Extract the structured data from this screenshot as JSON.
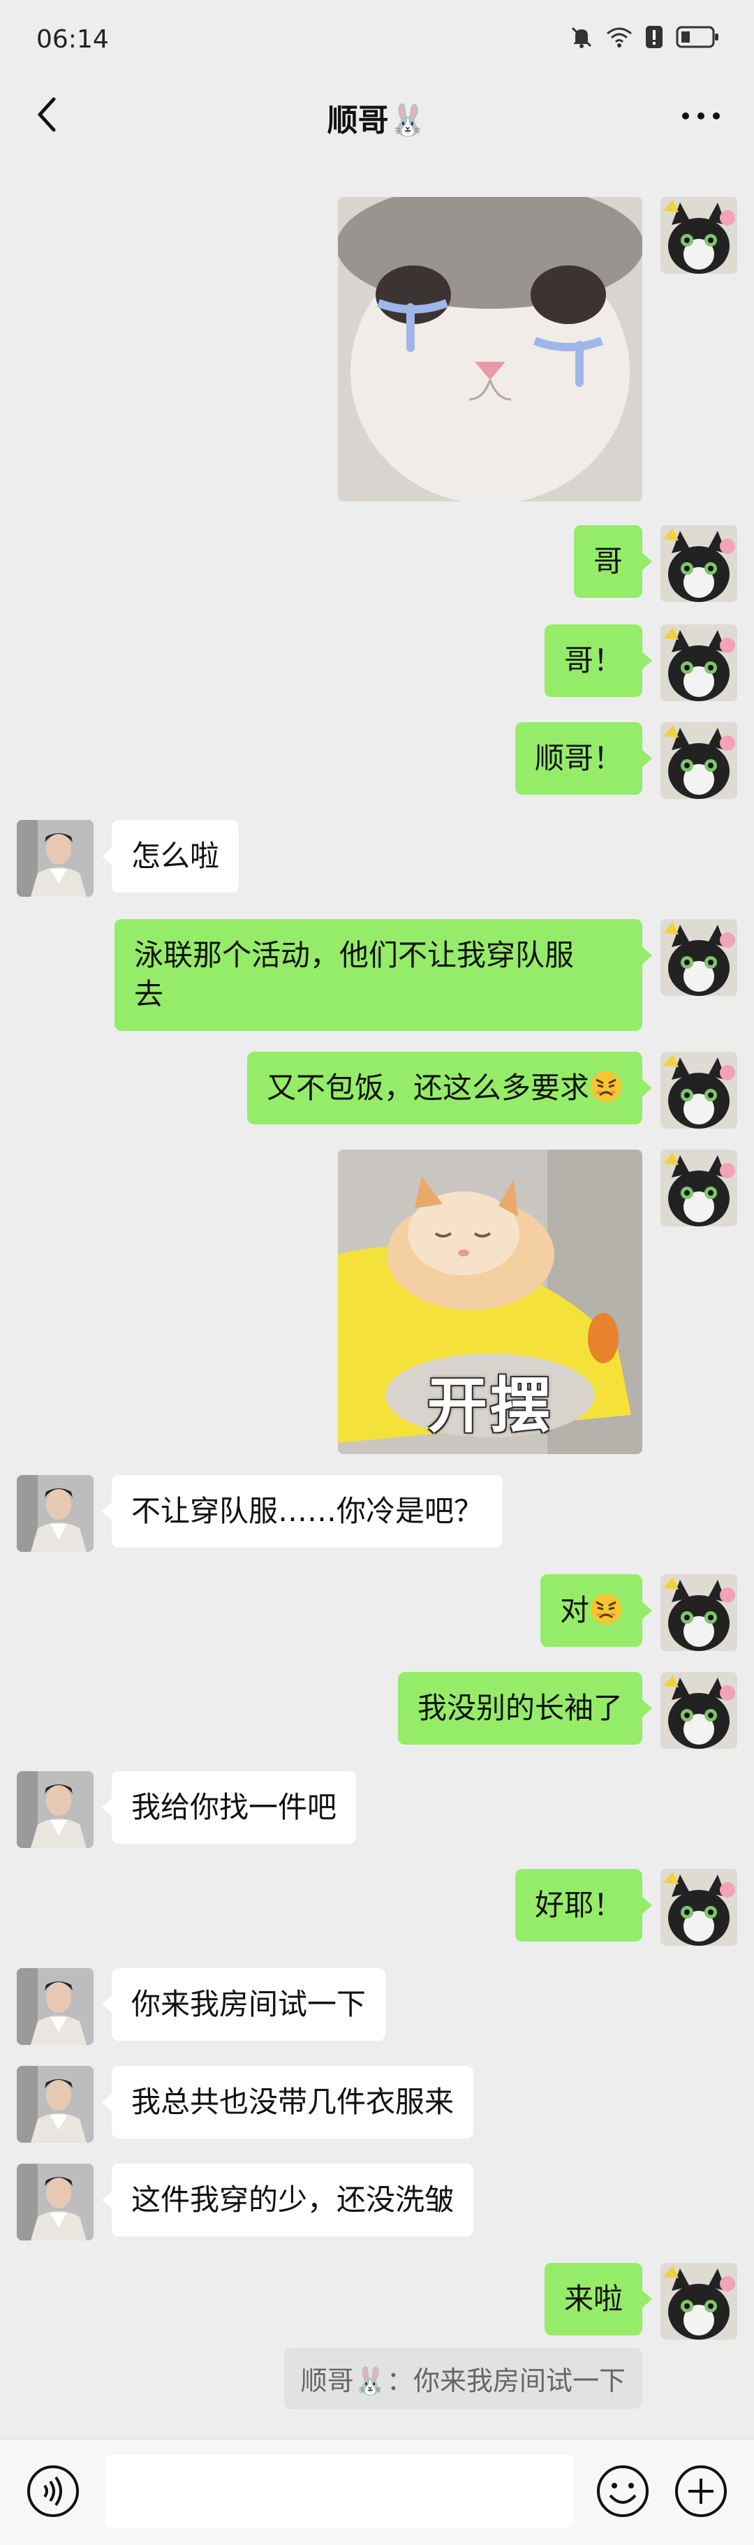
{
  "status": {
    "time": "06:14",
    "battery_icon": "battery-icon",
    "wifi_icon": "wifi-icon",
    "mute_icon": "mute-bell-icon"
  },
  "header": {
    "title": "顺哥🐰",
    "back_icon": "chevron-left-icon",
    "more_icon": "more-dots-icon"
  },
  "messages": [
    {
      "from": "me",
      "type": "sticker",
      "sticker_icon": "crying-cat-sticker"
    },
    {
      "from": "me",
      "text": "哥"
    },
    {
      "from": "me",
      "text": "哥！"
    },
    {
      "from": "me",
      "text": "顺哥！"
    },
    {
      "from": "other",
      "text": "怎么啦"
    },
    {
      "from": "me",
      "text_line1": "泳联那个活动，他们不让我穿队服",
      "text_line2": "去"
    },
    {
      "from": "me",
      "text": "又不包饭，还这么多要求",
      "emoji": "angry-face-emoji"
    },
    {
      "from": "me",
      "type": "sticker",
      "sticker_text": "开摆"
    },
    {
      "from": "other",
      "text": "不让穿队服……你冷是吧？"
    },
    {
      "from": "me",
      "text": "对",
      "emoji": "angry-face-emoji"
    },
    {
      "from": "me",
      "text": "我没别的长袖了"
    },
    {
      "from": "other",
      "text": "我给你找一件吧"
    },
    {
      "from": "me",
      "text": "好耶！"
    },
    {
      "from": "other",
      "text": "你来我房间试一下"
    },
    {
      "from": "other",
      "text": "我总共也没带几件衣服来"
    },
    {
      "from": "other",
      "text": "这件我穿的少，还没洗皱"
    },
    {
      "from": "me",
      "text": "来啦"
    }
  ],
  "quote": {
    "text": "顺哥🐰：你来我房间试一下"
  },
  "input_bar": {
    "value": "",
    "voice_icon": "voice-icon",
    "emoji_icon": "smiley-icon",
    "plus_icon": "plus-circle-icon"
  },
  "colors": {
    "background": "#ededed",
    "my_bubble": "#95ec69",
    "other_bubble": "#ffffff"
  }
}
